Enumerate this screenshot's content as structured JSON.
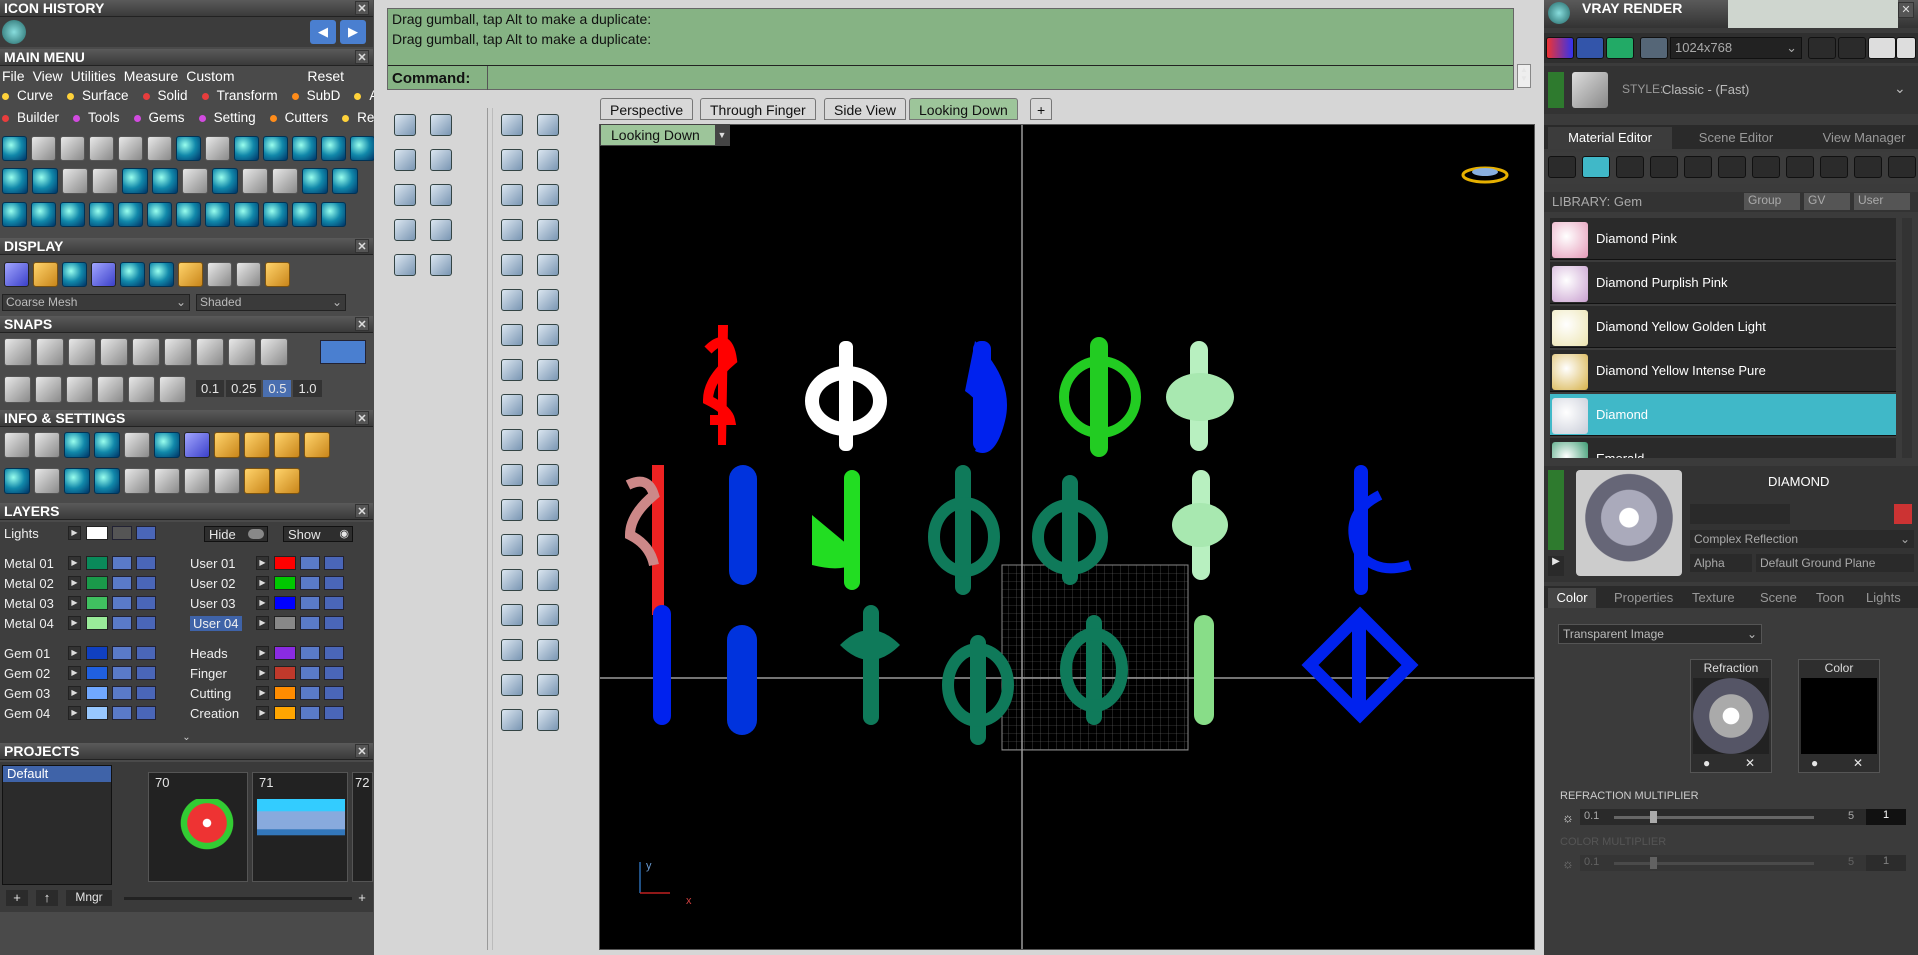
{
  "icon_history": {
    "title": "ICON HISTORY"
  },
  "main_menu": {
    "title": "MAIN MENU",
    "row1": [
      "File",
      "View",
      "Utilities",
      "Measure",
      "Custom"
    ],
    "reset": "Reset",
    "row2": [
      {
        "label": "Curve",
        "color": "#ffd23a"
      },
      {
        "label": "Surface",
        "color": "#ffd23a"
      },
      {
        "label": "Solid",
        "color": "#e83d3d"
      },
      {
        "label": "Transform",
        "color": "#e83d3d"
      },
      {
        "label": "SubD",
        "color": "#ff8c1a"
      },
      {
        "label": "Art",
        "color": "#ffd23a"
      }
    ],
    "row3": [
      {
        "label": "Builder",
        "color": "#e83d3d"
      },
      {
        "label": "Tools",
        "color": "#d24be0"
      },
      {
        "label": "Gems",
        "color": "#d24be0"
      },
      {
        "label": "Setting",
        "color": "#d24be0"
      },
      {
        "label": "Cutters",
        "color": "#ff8c1a"
      },
      {
        "label": "Render",
        "color": "#ffd23a"
      }
    ]
  },
  "display": {
    "title": "DISPLAY",
    "mesh": "Coarse Mesh",
    "shading": "Shaded"
  },
  "snaps": {
    "title": "SNAPS",
    "values": [
      "0.1",
      "0.25",
      "0.5",
      "1.0"
    ]
  },
  "info": {
    "title": "INFO & SETTINGS"
  },
  "layers": {
    "title": "LAYERS",
    "hide": "Hide",
    "show": "Show",
    "lights": "Lights",
    "left": [
      {
        "name": "Metal 01",
        "color": "#0a8a5a"
      },
      {
        "name": "Metal 02",
        "color": "#1a9a4a"
      },
      {
        "name": "Metal 03",
        "color": "#40c060"
      },
      {
        "name": "Metal 04",
        "color": "#9aec9a"
      },
      {
        "name": "Gem 01",
        "color": "#1040c0"
      },
      {
        "name": "Gem 02",
        "color": "#2060e0"
      },
      {
        "name": "Gem 03",
        "color": "#70a8ff"
      },
      {
        "name": "Gem 04",
        "color": "#98c8ff"
      }
    ],
    "right": [
      {
        "name": "User 01",
        "color": "#ff0000"
      },
      {
        "name": "User 02",
        "color": "#00c800"
      },
      {
        "name": "User 03",
        "color": "#0000ff"
      },
      {
        "name": "User 04",
        "color": "#888888"
      },
      {
        "name": "Heads",
        "color": "#8a2be2"
      },
      {
        "name": "Finger",
        "color": "#c0392b"
      },
      {
        "name": "Cutting",
        "color": "#ff8c00"
      },
      {
        "name": "Creation",
        "color": "#ffa500"
      }
    ]
  },
  "projects": {
    "title": "PROJECTS",
    "list": [
      "Default"
    ],
    "thumbs": [
      "70",
      "71",
      "72"
    ],
    "mngr": "Mngr"
  },
  "command": {
    "line1": "Drag gumball, tap Alt to make a duplicate:",
    "line2": "Drag gumball, tap Alt to make a duplicate:",
    "label": "Command:"
  },
  "viewport": {
    "tabs": [
      "Perspective",
      "Through Finger",
      "Side View",
      "Looking Down"
    ],
    "active": "Looking Down",
    "view_label": "Looking Down",
    "axis_y": "y",
    "axis_x": "x"
  },
  "vray": {
    "title": "VRAY RENDER",
    "resolution": "1024x768",
    "style_label": "STYLE:",
    "style_value": "Classic - (Fast)",
    "tabs": [
      "Material Editor",
      "Scene Editor",
      "View Manager"
    ],
    "library": "LIBRARY: Gem",
    "filters": [
      "Group",
      "GV",
      "User"
    ],
    "materials": [
      {
        "name": "Diamond Pink",
        "color": "#e59ab8"
      },
      {
        "name": "Diamond Purplish Pink",
        "color": "#c9a0d0"
      },
      {
        "name": "Diamond Yellow Golden Light",
        "color": "#ece4b0"
      },
      {
        "name": "Diamond Yellow Intense Pure",
        "color": "#d7b24a"
      },
      {
        "name": "Diamond",
        "color": "#c8ccd8"
      },
      {
        "name": "Emerald",
        "color": "#1a8a5a"
      }
    ],
    "selected": "Diamond",
    "mat_name": "DIAMOND",
    "reflection": "Complex Reflection",
    "alpha": "Alpha",
    "ground": "Default Ground Plane",
    "prop_tabs": [
      "Color",
      "Properties",
      "Texture",
      "Scene",
      "Toon",
      "Lights"
    ],
    "transparent": "Transparent Image",
    "refraction": "Refraction",
    "color": "Color",
    "refr_mult": "REFRACTION MULTIPLIER",
    "refr_min": "0.1",
    "refr_max": "5",
    "refr_val": "1",
    "col_mult": "COLOR MULTIPLIER",
    "col_min": "0.1",
    "col_max": "5",
    "col_val": "1"
  }
}
